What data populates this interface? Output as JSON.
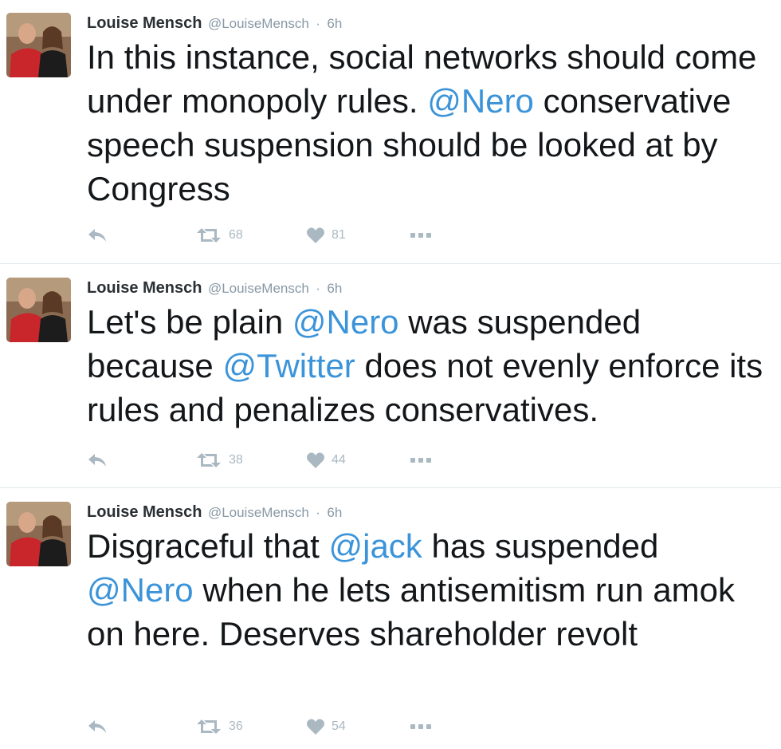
{
  "colors": {
    "text": "#14171a",
    "mention": "#3b94d9",
    "meta": "#8899a6",
    "action_icon": "#aab8c2",
    "divider": "#e1e8ed"
  },
  "tweets": [
    {
      "avatar_icon": "user-avatar-photo",
      "name": "Louise Mensch",
      "handle": "@LouiseMensch",
      "separator": "·",
      "time": "6h",
      "text": [
        {
          "t": "In this instance,  social networks should come under monopoly rules. "
        },
        {
          "t": "@Nero",
          "mention": true
        },
        {
          "t": " conservative speech suspension should be looked at by Congress"
        }
      ],
      "retweets": "68",
      "likes": "81"
    },
    {
      "avatar_icon": "user-avatar-photo",
      "name": "Louise Mensch",
      "handle": "@LouiseMensch",
      "separator": "·",
      "time": "6h",
      "text": [
        {
          "t": "Let's be plain "
        },
        {
          "t": "@Nero",
          "mention": true
        },
        {
          "t": " was suspended because "
        },
        {
          "t": "@Twitter",
          "mention": true
        },
        {
          "t": " does not evenly enforce its rules and penalizes conservatives."
        }
      ],
      "retweets": "38",
      "likes": "44"
    },
    {
      "avatar_icon": "user-avatar-photo",
      "name": "Louise Mensch",
      "handle": "@LouiseMensch",
      "separator": "·",
      "time": "6h",
      "text": [
        {
          "t": "Disgraceful that "
        },
        {
          "t": "@jack",
          "mention": true
        },
        {
          "t": " has suspended "
        },
        {
          "t": "@Nero",
          "mention": true
        },
        {
          "t": " when he lets antisemitism run amok on here. Deserves shareholder revolt"
        }
      ],
      "retweets": "36",
      "likes": "54"
    }
  ]
}
